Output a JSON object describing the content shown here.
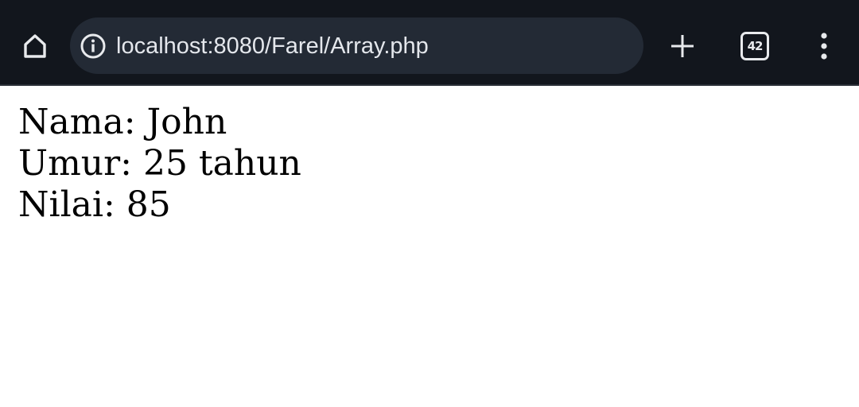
{
  "browser": {
    "url": "localhost:8080/Farel/Array.php",
    "tab_count": "42",
    "icons": {
      "home": "home-icon",
      "info": "info-icon",
      "new_tab": "plus-icon",
      "tabs": "tab-switcher-icon",
      "menu": "more-vert-icon"
    },
    "colors": {
      "toolbar_bg": "#12161d",
      "omnibox_bg": "#232a35",
      "icon_fg": "#e8eaed"
    }
  },
  "page": {
    "lines": [
      "Nama: John",
      "Umur: 25 tahun",
      "Nilai: 85"
    ]
  }
}
